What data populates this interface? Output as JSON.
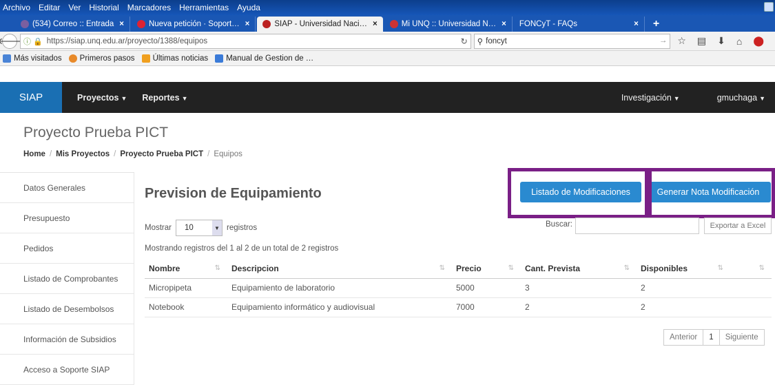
{
  "browser": {
    "menu": [
      "Archivo",
      "Editar",
      "Ver",
      "Historial",
      "Marcadores",
      "Herramientas",
      "Ayuda"
    ],
    "tabs": [
      {
        "label": "(534) Correo :: Entrada",
        "icon": "mail-icon",
        "color": "#7a5fa0"
      },
      {
        "label": "Nueva petición · Soport…",
        "icon": "ticket-icon",
        "color": "#d23"
      },
      {
        "label": "SIAP - Universidad Naci…",
        "icon": "siap-icon",
        "color": "#b22",
        "active": true
      },
      {
        "label": "Mi UNQ :: Universidad N…",
        "icon": "unq-icon",
        "color": "#c33"
      },
      {
        "label": "FONCyT - FAQs",
        "icon": "doc-icon",
        "color": "#1a57b4"
      }
    ],
    "url": "https://siap.unq.edu.ar/proyecto/1388/equipos",
    "search": "foncyt",
    "bookmarks": [
      "Más visitados",
      "Primeros pasos",
      "Últimas noticias",
      "Manual de Gestion de …"
    ]
  },
  "app": {
    "brand": "SIAP",
    "nav_left": [
      "Proyectos",
      "Reportes"
    ],
    "nav_right": [
      "Investigación",
      "gmuchaga"
    ],
    "page_title": "Proyecto Prueba PICT",
    "breadcrumb": [
      "Home",
      "Mis Proyectos",
      "Proyecto Prueba PICT",
      "Equipos"
    ],
    "sidebar": [
      "Datos Generales",
      "Presupuesto",
      "Pedidos",
      "Listado de Comprobantes",
      "Listado de Desembolsos",
      "Información de Subsidios",
      "Acceso a Soporte SIAP"
    ],
    "section_title": "Prevision de Equipamiento",
    "btn_listado": "Listado de Modificaciones",
    "btn_generar": "Generar Nota Modificación",
    "mostrar_label": "Mostrar",
    "page_size": "10",
    "registros_label": "registros",
    "buscar_label": "Buscar:",
    "export_label": "Exportar a Excel",
    "info": "Mostrando registros del 1 al 2 de un total de 2 registros",
    "columns": [
      "Nombre",
      "Descripcion",
      "Precio",
      "Cant. Prevista",
      "Disponibles",
      ""
    ],
    "rows": [
      [
        "Micropipeta",
        "Equipamiento de laboratorio",
        "5000",
        "3",
        "2",
        ""
      ],
      [
        "Notebook",
        "Equipamiento informático y audiovisual",
        "7000",
        "2",
        "2",
        ""
      ]
    ],
    "pager": {
      "prev": "Anterior",
      "page": "1",
      "next": "Siguiente"
    },
    "colors": {
      "brand_bg": "#1a6fb3",
      "nav_bg": "#222222",
      "primary": "#2a8ad0",
      "highlight": "#7a1f86"
    }
  }
}
